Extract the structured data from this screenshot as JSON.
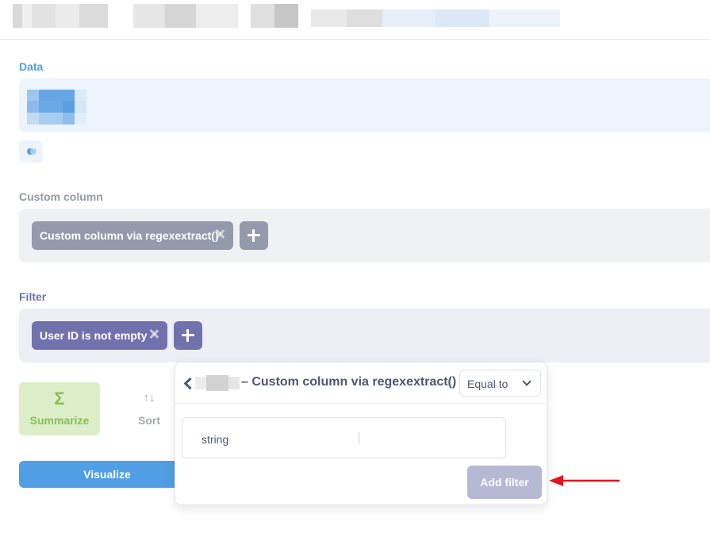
{
  "sections": {
    "data_label": "Data",
    "custom_column_label": "Custom column",
    "filter_label": "Filter"
  },
  "custom_column": {
    "pill_label": "Custom column via regexextract()"
  },
  "filter": {
    "pill_label": "User ID is not empty"
  },
  "actions": {
    "summarize_label": "Summarize",
    "summarize_icon": "Σ",
    "sort_label": "Sort",
    "sort_icon": "↑↓",
    "visualize_label": "Visualize"
  },
  "popover": {
    "title": "– Custom column via regexextract()",
    "operator": "Equal to",
    "value": "string",
    "add_filter_label": "Add filter"
  },
  "colors": {
    "accent_blue": "#509ee3",
    "filter_purple": "#7172ad",
    "custom_gray": "#949aab",
    "summarize_green": "#88bf4d",
    "annotation_red": "#e8141b"
  }
}
